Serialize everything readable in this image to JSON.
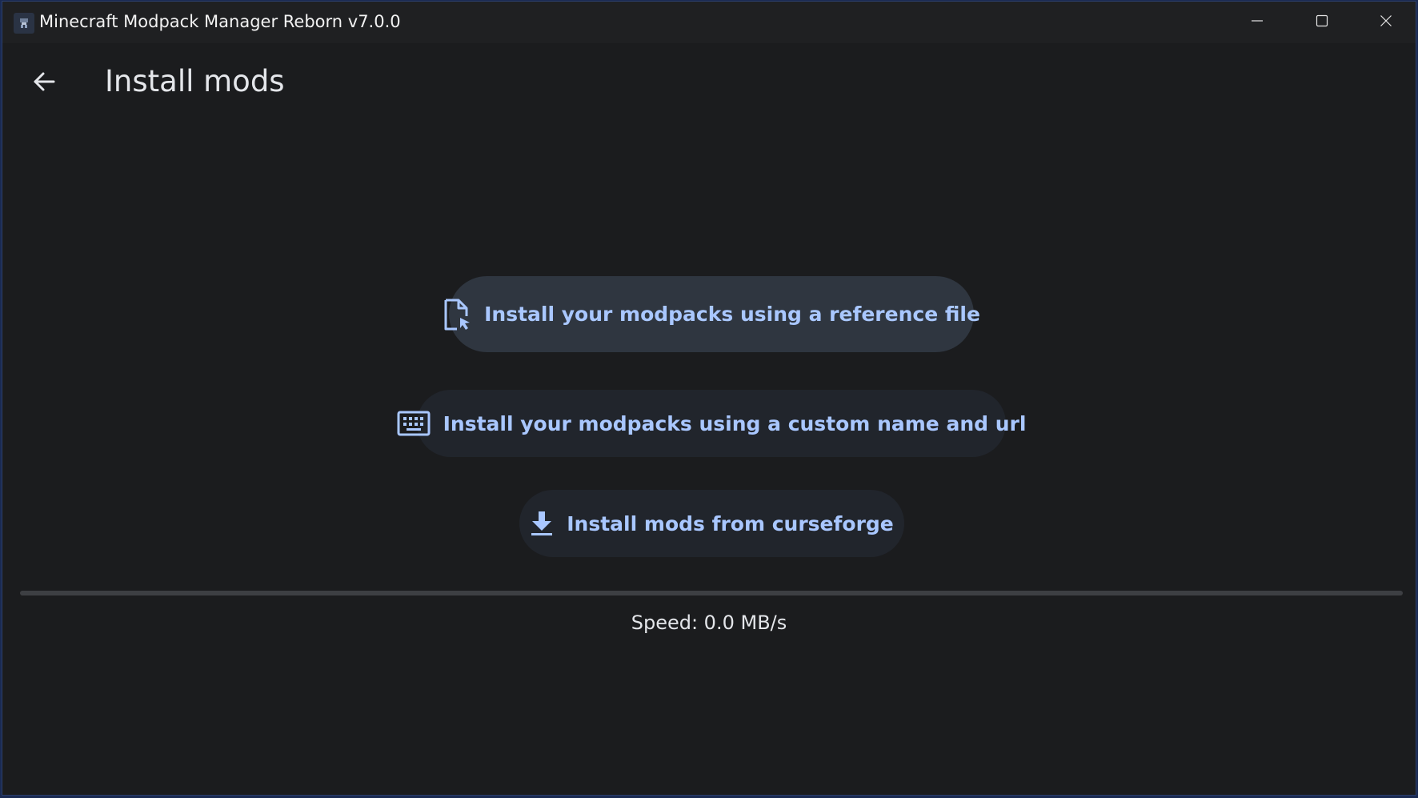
{
  "window": {
    "title": "Minecraft Modpack Manager Reborn v7.0.0",
    "controls": [
      "minimize-icon",
      "maximize-icon",
      "close-icon"
    ]
  },
  "header": {
    "back_icon": "arrow-left-icon",
    "title": "Install mods"
  },
  "actions": [
    {
      "label": "Install your modpacks using a reference file",
      "icon": "file-cursor-icon"
    },
    {
      "label": "Install your modpacks using a custom name and url",
      "icon": "keyboard-icon"
    },
    {
      "label": "Install mods from curseforge",
      "icon": "download-icon"
    }
  ],
  "progress": {
    "fraction": 0.0,
    "speed_text": "Speed: 0.0 MB/s"
  },
  "colors": {
    "background": "#1b1c1e",
    "titlebar": "#1f2022",
    "accent": "#a9c7ff",
    "primary_button": "#2f3640",
    "secondary_button": "#21252c",
    "text": "#e4e6ea"
  }
}
